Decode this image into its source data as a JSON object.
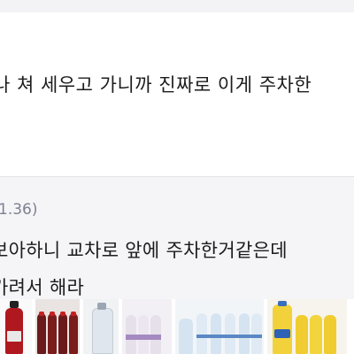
{
  "post": {
    "text": "나 쳐 세우고 가니까 진짜로 이게 주차한"
  },
  "comment": {
    "meta": "1.36)",
    "line1": "보아하니 교차로 앞에 주차한거같은데 ",
    "line2": "가려서 해라"
  },
  "colors": {
    "comment_background": "#f5f5f8",
    "meta_text": "#7d8190",
    "body_text": "#1c1c1c"
  },
  "product_strip": {
    "icons": [
      "red-soda-bottle-image",
      "cola-bottles-image",
      "water-bottle-image",
      "purple-label-bottles-image",
      "blue-water-bottles-image",
      "yellow-drink-bottles-image"
    ]
  }
}
